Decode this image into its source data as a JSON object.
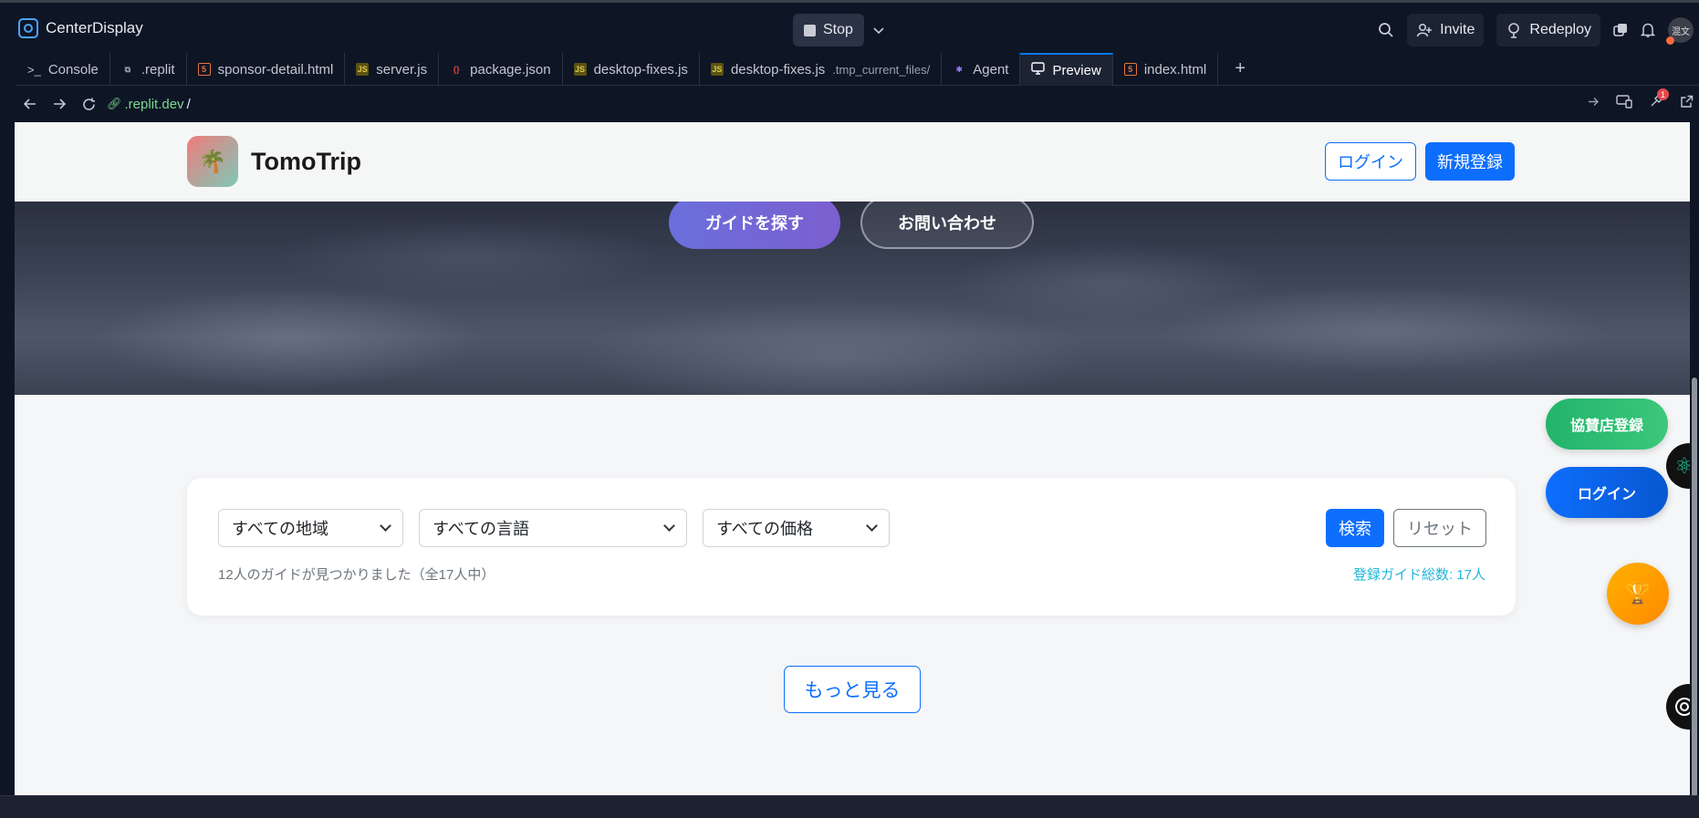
{
  "ide": {
    "app_title": "CenterDisplay",
    "stop_label": "Stop",
    "invite_label": "Invite",
    "redeploy_label": "Redeploy",
    "avatar_text": "混文",
    "tabs": [
      {
        "label": "Console",
        "icon": "terminal-icon"
      },
      {
        "label": ".replit",
        "icon": "replit-file-icon"
      },
      {
        "label": "sponsor-detail.html",
        "icon": "html-file-icon"
      },
      {
        "label": "server.js",
        "icon": "js-file-icon"
      },
      {
        "label": "package.json",
        "icon": "json-file-icon"
      },
      {
        "label": "desktop-fixes.js",
        "icon": "js-file-icon"
      },
      {
        "label": "desktop-fixes.js",
        "sub": ".tmp_current_files/",
        "icon": "js-file-icon"
      },
      {
        "label": "Agent",
        "icon": "agent-icon"
      },
      {
        "label": "Preview",
        "icon": "monitor-icon",
        "active": true
      },
      {
        "label": "index.html",
        "icon": "html-file-icon"
      }
    ],
    "url_domain": ".replit.dev",
    "url_path": "/",
    "devtools_badge": "1"
  },
  "site": {
    "brand_name": "TomoTrip",
    "brand_emoji": "🌴",
    "header_login": "ログイン",
    "header_register": "新規登録",
    "hero_find_guide": "ガイドを探す",
    "hero_contact": "お問い合わせ",
    "search": {
      "region_value": "すべての地域",
      "language_value": "すべての言語",
      "price_value": "すべての価格",
      "search_button": "検索",
      "reset_button": "リセット",
      "result_text": "12人のガイドが見つかりました（全17人中）",
      "total_text": "登録ガイド総数: 17人"
    },
    "more_button": "もっと見る",
    "float_sponsor": "協賛店登録",
    "float_login": "ログイン",
    "float_trophy_emoji": "🏆"
  },
  "colors": {
    "primary": "#0d6efd",
    "sponsor_green": "#22b46a",
    "accent_cyan": "#20b5d8",
    "ide_bg": "#0e1525"
  }
}
